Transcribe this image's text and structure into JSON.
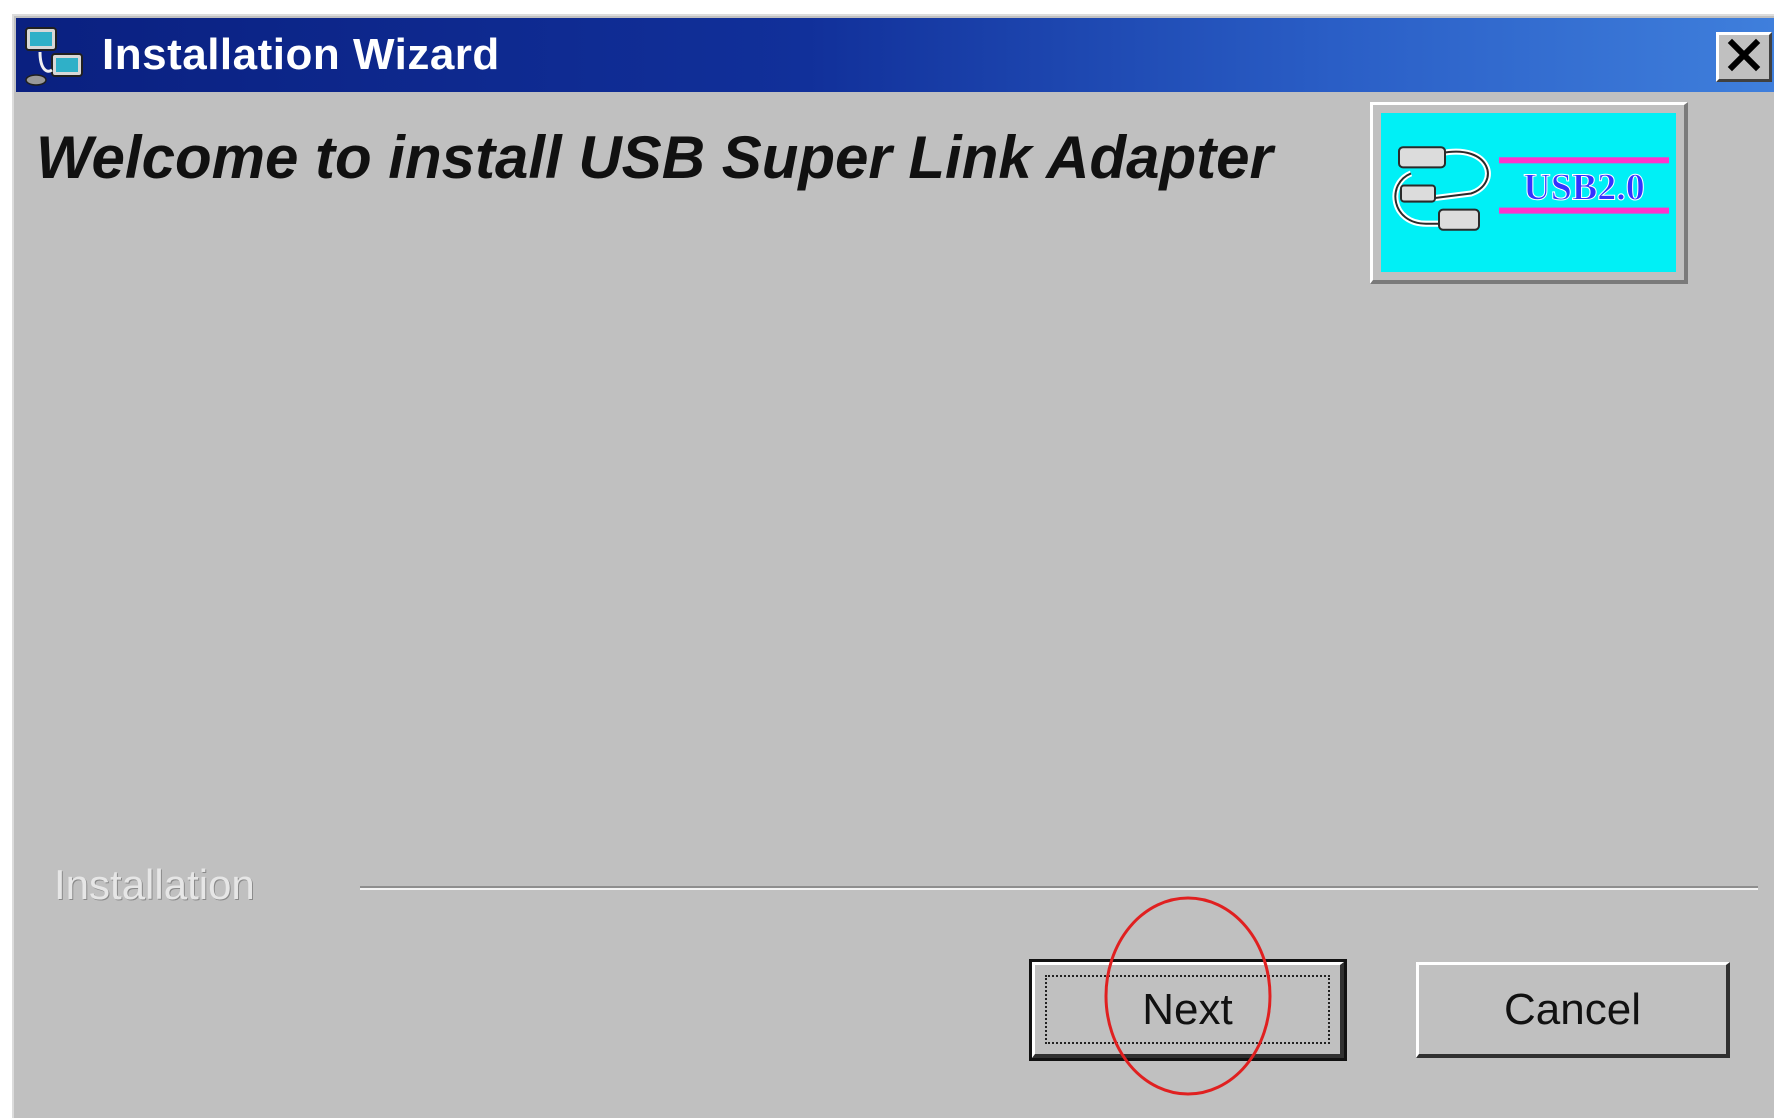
{
  "window": {
    "title": "Installation Wizard",
    "title_bar_color": "#0a2080",
    "background_color": "#c0c0c0",
    "icons": {
      "app": "installer-computers-icon",
      "close": "close-icon"
    }
  },
  "header": {
    "welcome_text": "Welcome to install USB Super Link Adapter",
    "logo": {
      "text": "USB2.0",
      "icon": "usb-cable-icon",
      "background_color": "#00f0f6",
      "text_color": "#3333ff",
      "stripe_color": "#ff33cc"
    }
  },
  "footer": {
    "section_label": "Installation",
    "buttons": {
      "next_label": "Next",
      "cancel_label": "Cancel"
    },
    "annotation": {
      "type": "red-circle-highlight",
      "target": "next-button",
      "color": "#e02020"
    }
  }
}
